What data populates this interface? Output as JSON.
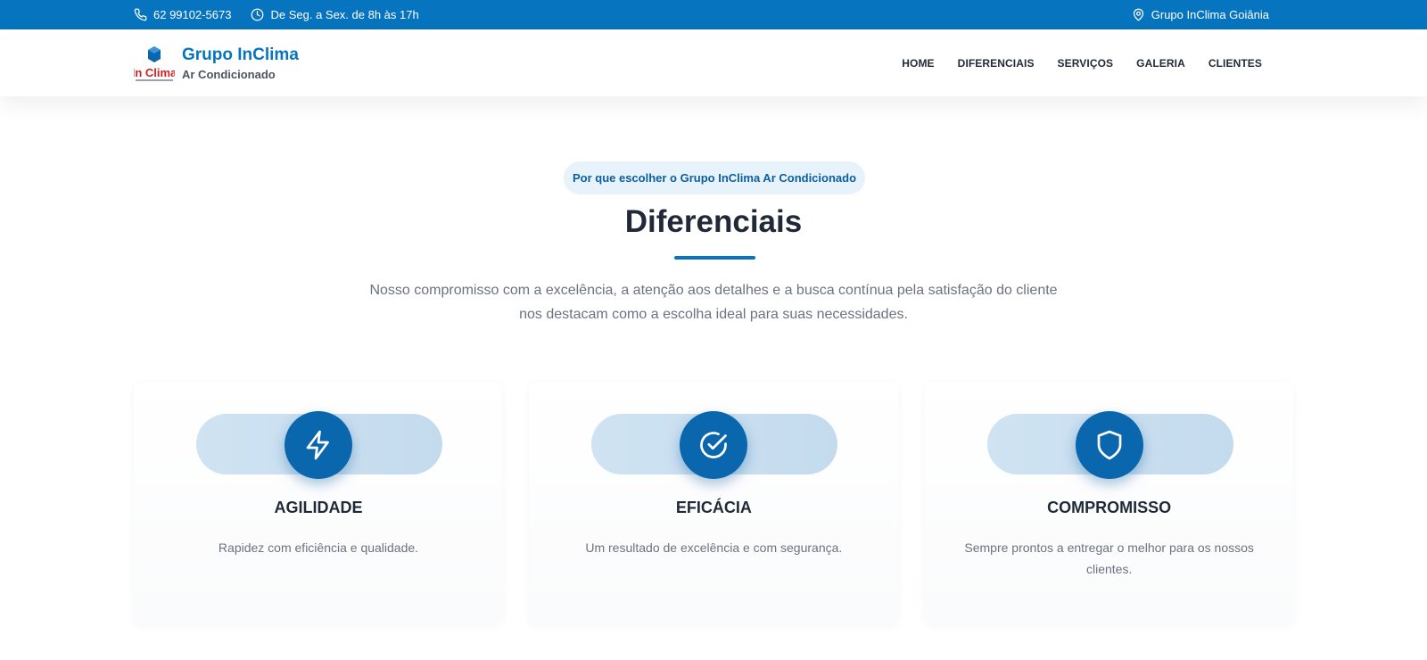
{
  "topbar": {
    "phone": "62 99102-5673",
    "hours": "De Seg. a Sex. de 8h às 17h",
    "location": "Grupo InClima Goiânia"
  },
  "header": {
    "brand_name": "Grupo InClima",
    "brand_sub": "Ar Condicionado",
    "logo_text": "In Clima",
    "nav": [
      "HOME",
      "DIFERENCIAIS",
      "SERVIÇOS",
      "GALERIA",
      "CLIENTES"
    ]
  },
  "section": {
    "pill": "Por que escolher o Grupo InClima Ar Condicionado",
    "title": "Diferenciais",
    "lead": "Nosso compromisso com a excelência, a atenção aos detalhes e a busca contínua pela satisfação do cliente nos destacam como a escolha ideal para suas necessidades.",
    "cards": [
      {
        "icon": "lightning-icon",
        "title": "AGILIDADE",
        "text": "Rapidez com eficiência e qualidade."
      },
      {
        "icon": "check-circle-icon",
        "title": "EFICÁCIA",
        "text": "Um resultado de excelência e com segurança."
      },
      {
        "icon": "shield-icon",
        "title": "COMPROMISSO",
        "text": "Sempre prontos a entregar o melhor para os nossos clientes."
      }
    ]
  },
  "colors": {
    "brand_blue": "#0774bf",
    "icon_circle": "#0a66ad",
    "pill_bg": "#e7f2fb",
    "logo_red": "#d32020"
  }
}
